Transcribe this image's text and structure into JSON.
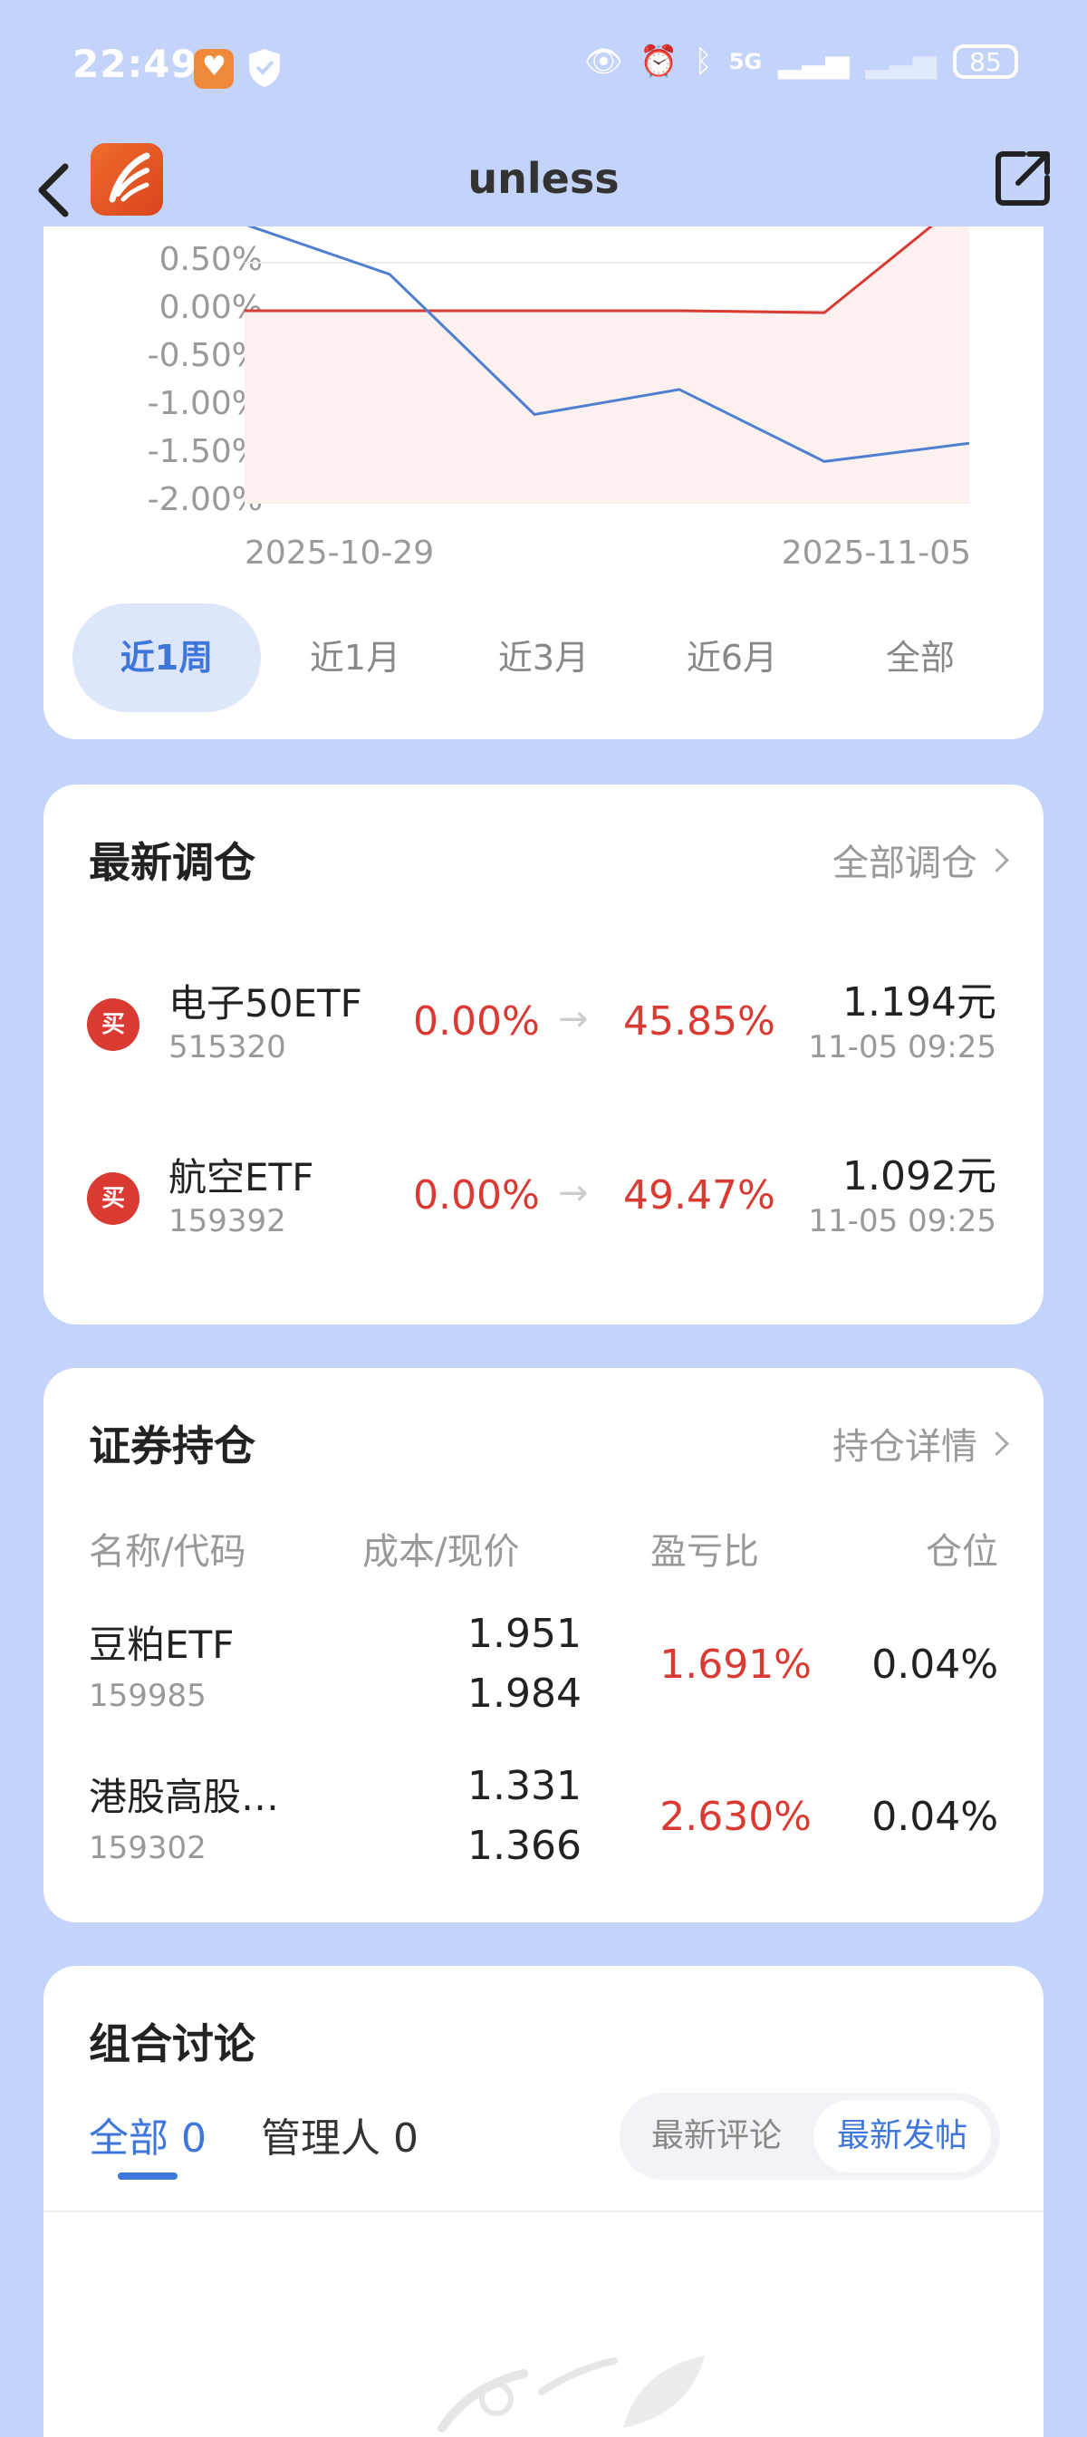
{
  "status_bar": {
    "time": "22:49",
    "battery": "85",
    "network": "5G"
  },
  "header": {
    "title": "unless"
  },
  "chart_data": {
    "type": "line",
    "y_ticks": [
      "0.50%",
      "0.00%",
      "-0.50%",
      "-1.00%",
      "-1.50%",
      "-2.00%"
    ],
    "x_tick_labels": [
      "2025-10-29",
      "2025-11-05"
    ],
    "ylim": [
      -2.0,
      0.5
    ],
    "series": [
      {
        "color": "#d93a32",
        "x": [
          "2025-10-29",
          "2025-10-30",
          "2025-10-31",
          "2025-11-03",
          "2025-11-04",
          "2025-11-05"
        ],
        "values": [
          0.0,
          0.0,
          0.0,
          0.0,
          -0.02,
          1.2
        ]
      },
      {
        "color": "#4f7fd0",
        "x": [
          "2025-10-29",
          "2025-10-30",
          "2025-10-31",
          "2025-11-03",
          "2025-11-04",
          "2025-11-05"
        ],
        "values": [
          0.9,
          0.38,
          -1.08,
          -0.82,
          -1.57,
          -1.38
        ]
      }
    ],
    "grid": true
  },
  "periods": [
    "近1周",
    "近1月",
    "近3月",
    "近6月",
    "全部"
  ],
  "rebalance": {
    "title": "最新调仓",
    "link": "全部调仓",
    "trades": [
      {
        "badge": "买",
        "name": "电子50ETF",
        "code": "515320",
        "from": "0.00%",
        "arrow": "→",
        "to": "45.85%",
        "price": "1.194元",
        "time": "11-05 09:25"
      },
      {
        "badge": "买",
        "name": "航空ETF",
        "code": "159392",
        "from": "0.00%",
        "arrow": "→",
        "to": "49.47%",
        "price": "1.092元",
        "time": "11-05 09:25"
      }
    ]
  },
  "holdings": {
    "title": "证券持仓",
    "link": "持仓详情",
    "columns": [
      "名称/代码",
      "成本/现价",
      "盈亏比",
      "仓位"
    ],
    "rows": [
      {
        "name": "豆粕ETF",
        "code": "159985",
        "cost": "1.951",
        "price": "1.984",
        "pnl": "1.691%",
        "position": "0.04%"
      },
      {
        "name": "港股高股…",
        "code": "159302",
        "cost": "1.331",
        "price": "1.366",
        "pnl": "2.630%",
        "position": "0.04%"
      }
    ]
  },
  "discussion": {
    "title": "组合讨论",
    "tabs": [
      "全部 0",
      "管理人 0"
    ],
    "sort_options": [
      "最新评论",
      "最新发帖"
    ]
  }
}
